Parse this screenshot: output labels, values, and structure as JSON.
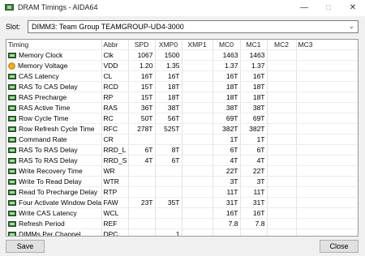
{
  "window": {
    "title": "DRAM Timings - AIDA64"
  },
  "slot": {
    "label": "Slot:",
    "value": "DIMM3: Team Group TEAMGROUP-UD4-3000"
  },
  "columns": [
    "Timing",
    "Abbr",
    "SPD",
    "XMP0",
    "XMP1",
    "MC0",
    "MC1",
    "MC2",
    "MC3"
  ],
  "rows": [
    {
      "icon": "ram-icon",
      "timing": "Memory Clock",
      "abbr": "Clk",
      "spd": "1067",
      "xmp0": "1500",
      "xmp1": "",
      "mc0": "1463",
      "mc1": "1463",
      "mc2": "",
      "mc3": ""
    },
    {
      "icon": "gauge-icon",
      "timing": "Memory Voltage",
      "abbr": "VDD",
      "spd": "1.20",
      "xmp0": "1.35",
      "xmp1": "",
      "mc0": "1.37",
      "mc1": "1.37",
      "mc2": "",
      "mc3": ""
    },
    {
      "icon": "ram-icon",
      "timing": "CAS Latency",
      "abbr": "CL",
      "spd": "16T",
      "xmp0": "16T",
      "xmp1": "",
      "mc0": "16T",
      "mc1": "16T",
      "mc2": "",
      "mc3": ""
    },
    {
      "icon": "ram-icon",
      "timing": "RAS To CAS Delay",
      "abbr": "RCD",
      "spd": "15T",
      "xmp0": "18T",
      "xmp1": "",
      "mc0": "18T",
      "mc1": "18T",
      "mc2": "",
      "mc3": ""
    },
    {
      "icon": "ram-icon",
      "timing": "RAS Precharge",
      "abbr": "RP",
      "spd": "15T",
      "xmp0": "18T",
      "xmp1": "",
      "mc0": "18T",
      "mc1": "18T",
      "mc2": "",
      "mc3": ""
    },
    {
      "icon": "ram-icon",
      "timing": "RAS Active Time",
      "abbr": "RAS",
      "spd": "36T",
      "xmp0": "38T",
      "xmp1": "",
      "mc0": "38T",
      "mc1": "38T",
      "mc2": "",
      "mc3": ""
    },
    {
      "icon": "ram-icon",
      "timing": "Row Cycle Time",
      "abbr": "RC",
      "spd": "50T",
      "xmp0": "56T",
      "xmp1": "",
      "mc0": "69T",
      "mc1": "69T",
      "mc2": "",
      "mc3": ""
    },
    {
      "icon": "ram-icon",
      "timing": "Row Refresh Cycle Time",
      "abbr": "RFC",
      "spd": "278T",
      "xmp0": "525T",
      "xmp1": "",
      "mc0": "382T",
      "mc1": "382T",
      "mc2": "",
      "mc3": ""
    },
    {
      "icon": "ram-icon",
      "timing": "Command Rate",
      "abbr": "CR",
      "spd": "",
      "xmp0": "",
      "xmp1": "",
      "mc0": "1T",
      "mc1": "1T",
      "mc2": "",
      "mc3": ""
    },
    {
      "icon": "ram-icon",
      "timing": "RAS To RAS Delay",
      "abbr": "RRD_L",
      "spd": "6T",
      "xmp0": "8T",
      "xmp1": "",
      "mc0": "6T",
      "mc1": "6T",
      "mc2": "",
      "mc3": ""
    },
    {
      "icon": "ram-icon",
      "timing": "RAS To RAS Delay",
      "abbr": "RRD_S",
      "spd": "4T",
      "xmp0": "6T",
      "xmp1": "",
      "mc0": "4T",
      "mc1": "4T",
      "mc2": "",
      "mc3": ""
    },
    {
      "icon": "ram-icon",
      "timing": "Write Recovery Time",
      "abbr": "WR",
      "spd": "",
      "xmp0": "",
      "xmp1": "",
      "mc0": "22T",
      "mc1": "22T",
      "mc2": "",
      "mc3": ""
    },
    {
      "icon": "ram-icon",
      "timing": "Write To Read Delay",
      "abbr": "WTR",
      "spd": "",
      "xmp0": "",
      "xmp1": "",
      "mc0": "3T",
      "mc1": "3T",
      "mc2": "",
      "mc3": ""
    },
    {
      "icon": "ram-icon",
      "timing": "Read To Precharge Delay",
      "abbr": "RTP",
      "spd": "",
      "xmp0": "",
      "xmp1": "",
      "mc0": "11T",
      "mc1": "11T",
      "mc2": "",
      "mc3": ""
    },
    {
      "icon": "ram-icon",
      "timing": "Four Activate Window Delay",
      "abbr": "FAW",
      "spd": "23T",
      "xmp0": "35T",
      "xmp1": "",
      "mc0": "31T",
      "mc1": "31T",
      "mc2": "",
      "mc3": ""
    },
    {
      "icon": "ram-icon",
      "timing": "Write CAS Latency",
      "abbr": "WCL",
      "spd": "",
      "xmp0": "",
      "xmp1": "",
      "mc0": "16T",
      "mc1": "16T",
      "mc2": "",
      "mc3": ""
    },
    {
      "icon": "ram-icon",
      "timing": "Refresh Period",
      "abbr": "REF",
      "spd": "",
      "xmp0": "",
      "xmp1": "",
      "mc0": "7.8",
      "mc1": "7.8",
      "mc2": "",
      "mc3": ""
    },
    {
      "icon": "ram-icon",
      "timing": "DIMMs Per Channel",
      "abbr": "DPC",
      "spd": "",
      "xmp0": "1",
      "xmp1": "",
      "mc0": "",
      "mc1": "",
      "mc2": "",
      "mc3": ""
    }
  ],
  "buttons": {
    "save": "Save",
    "close": "Close"
  }
}
